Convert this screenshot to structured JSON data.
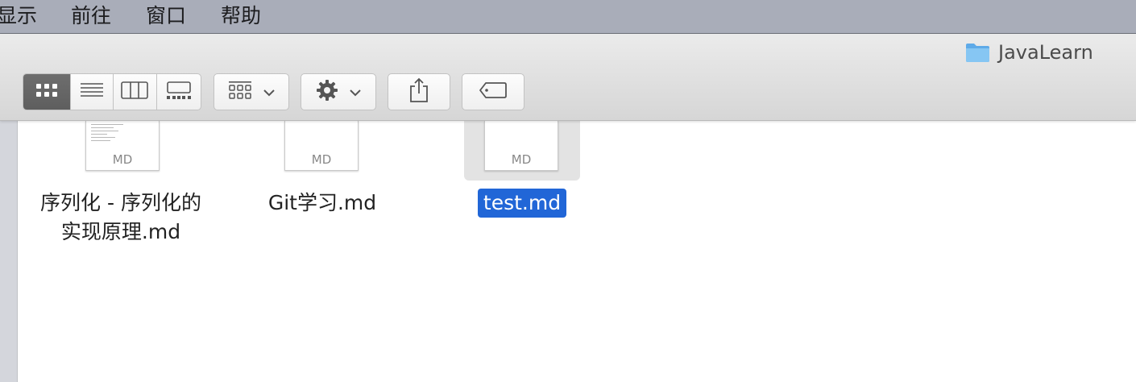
{
  "menubar": {
    "items": [
      {
        "label": "显示"
      },
      {
        "label": "前往"
      },
      {
        "label": "窗口"
      },
      {
        "label": "帮助"
      }
    ]
  },
  "window": {
    "title": "JavaLearn",
    "title_icon": "folder-icon"
  },
  "toolbar": {
    "view_modes": [
      {
        "name": "icon-view",
        "icon": "grid-icon",
        "active": true
      },
      {
        "name": "list-view",
        "icon": "list-icon",
        "active": false
      },
      {
        "name": "column-view",
        "icon": "columns-icon",
        "active": false
      },
      {
        "name": "gallery-view",
        "icon": "gallery-icon",
        "active": false
      }
    ],
    "arrange_icon": "arrange-grid-icon",
    "action_icon": "gear-icon",
    "share_icon": "share-icon",
    "tag_icon": "tag-icon"
  },
  "files": [
    {
      "name": "序列化 - 序列化的\n实现原理.md",
      "ext": "MD",
      "selected": false,
      "thumb_has_text": true
    },
    {
      "name": "Git学习.md",
      "ext": "MD",
      "selected": false,
      "thumb_has_text": false
    },
    {
      "name": "test.md",
      "ext": "MD",
      "selected": true,
      "thumb_has_text": false
    }
  ],
  "colors": {
    "menubar_bg": "#a9adb9",
    "selection": "#2166d7",
    "folder": "#6fb8ef"
  }
}
